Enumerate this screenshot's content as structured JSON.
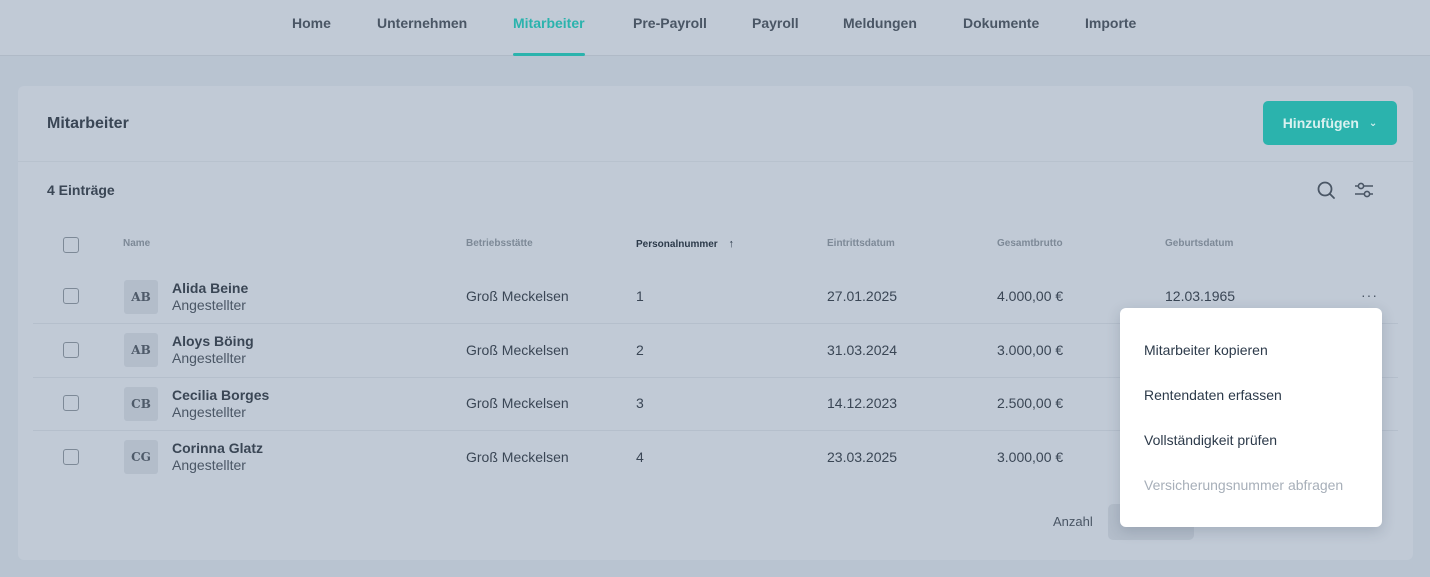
{
  "nav": {
    "items": [
      {
        "label": "Home"
      },
      {
        "label": "Unternehmen"
      },
      {
        "label": "Mitarbeiter",
        "active": true
      },
      {
        "label": "Pre-Payroll"
      },
      {
        "label": "Payroll"
      },
      {
        "label": "Meldungen"
      },
      {
        "label": "Dokumente"
      },
      {
        "label": "Importe"
      }
    ]
  },
  "card": {
    "title": "Mitarbeiter",
    "add_button": "Hinzufügen",
    "count": "4 Einträge",
    "icons": [
      "search-icon",
      "filter-sliders-icon"
    ]
  },
  "table": {
    "headers": {
      "name": "Name",
      "location": "Betriebsstätte",
      "number": "Personalnummer",
      "entry": "Eintrittsdatum",
      "gross": "Gesamtbrutto",
      "birth": "Geburtsdatum"
    },
    "sort_icon": "arrow-up-icon",
    "rows": [
      {
        "initials": "AB",
        "name": "Alida Beine",
        "role": "Angestellter",
        "location": "Groß Meckelsen",
        "number": "1",
        "entry": "27.01.2025",
        "gross": "4.000,00 €",
        "birth": "12.03.1965"
      },
      {
        "initials": "AB",
        "name": "Aloys Böing",
        "role": "Angestellter",
        "location": "Groß Meckelsen",
        "number": "2",
        "entry": "31.03.2024",
        "gross": "3.000,00 €",
        "birth": ""
      },
      {
        "initials": "CB",
        "name": "Cecilia Borges",
        "role": "Angestellter",
        "location": "Groß Meckelsen",
        "number": "3",
        "entry": "14.12.2023",
        "gross": "2.500,00 €",
        "birth": ""
      },
      {
        "initials": "CG",
        "name": "Corinna Glatz",
        "role": "Angestellter",
        "location": "Groß Meckelsen",
        "number": "4",
        "entry": "23.03.2025",
        "gross": "3.000,00 €",
        "birth": ""
      }
    ],
    "row_menu": "···"
  },
  "pagination": {
    "label": "Anzahl"
  },
  "context_menu": {
    "items": [
      {
        "label": "Mitarbeiter kopieren"
      },
      {
        "label": "Rentendaten erfassen"
      },
      {
        "label": "Vollständigkeit prüfen"
      },
      {
        "label": "Versicherungsnummer abfragen",
        "disabled": true
      }
    ]
  },
  "colors": {
    "accent": "#2bb3ad",
    "overlay_bg": "#b9c4d1"
  }
}
